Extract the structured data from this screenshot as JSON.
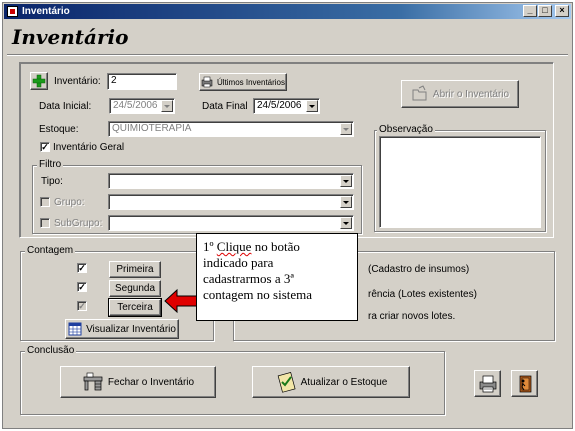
{
  "window": {
    "title": "Inventário",
    "controls": [
      "_",
      "□",
      "×"
    ]
  },
  "header": {
    "title": "Inventário"
  },
  "form": {
    "inventario_label": "Inventário:",
    "inventario_value": "2",
    "ultimos_button": "Últimos Inventários",
    "abrir_button": "Abrir o Inventário",
    "data_inicial_label": "Data Inicial:",
    "data_inicial_value": "24/5/2006",
    "data_final_label": "Data Final",
    "data_final_value": "24/5/2006",
    "estoque_label": "Estoque:",
    "estoque_value": "QUIMIOTERAPIA",
    "inventario_geral_label": "Inventário Geral",
    "observacao_label": "Observação"
  },
  "filtro": {
    "legend": "Filtro",
    "tipo_label": "Tipo:",
    "grupo_label": "Grupo:",
    "subgrupo_label": "SubGrupo:"
  },
  "contagem": {
    "legend": "Contagem",
    "primeira": "Primeira",
    "segunda": "Segunda",
    "terceira": "Terceira",
    "visualizar": "Visualizar Inventário"
  },
  "options": {
    "opt1": "(Cadastro de insumos)",
    "opt2": "rência (Lotes existentes)",
    "opt3": "ra criar novos lotes."
  },
  "conclusao": {
    "legend": "Conclusão",
    "fechar": "Fechar o Inventário",
    "atualizar": "Atualizar o Estoque"
  },
  "callout": {
    "line1_prefix": "1º ",
    "line1_word": "Clique",
    "line1_suffix": " no botão",
    "line2": "indicado para",
    "line3": "cadastrarmos a 3ª",
    "line4": "contagem no sistema"
  },
  "colors": {
    "title_bar": "#0a246a",
    "arrow": "#e00000",
    "face": "#d4d0c8"
  }
}
